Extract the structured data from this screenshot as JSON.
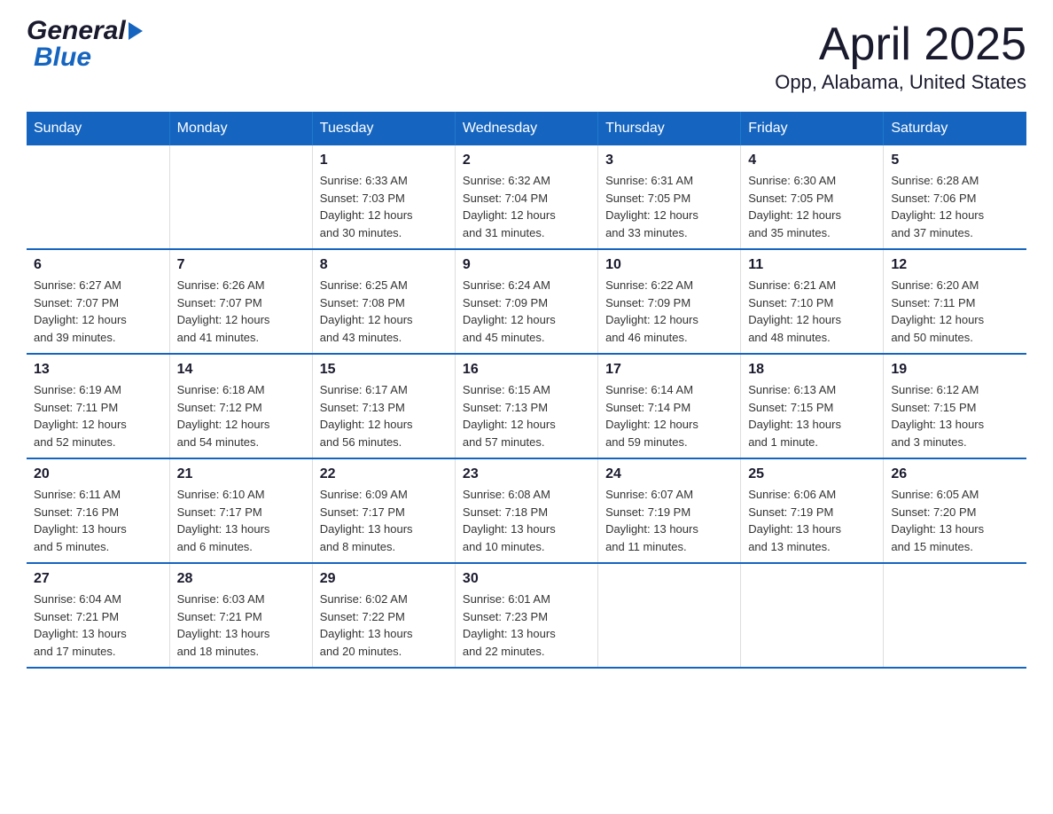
{
  "header": {
    "logo_general": "General",
    "logo_blue": "Blue",
    "month_title": "April 2025",
    "location": "Opp, Alabama, United States"
  },
  "days_of_week": [
    "Sunday",
    "Monday",
    "Tuesday",
    "Wednesday",
    "Thursday",
    "Friday",
    "Saturday"
  ],
  "weeks": [
    {
      "days": [
        {
          "number": "",
          "info": ""
        },
        {
          "number": "",
          "info": ""
        },
        {
          "number": "1",
          "info": "Sunrise: 6:33 AM\nSunset: 7:03 PM\nDaylight: 12 hours\nand 30 minutes."
        },
        {
          "number": "2",
          "info": "Sunrise: 6:32 AM\nSunset: 7:04 PM\nDaylight: 12 hours\nand 31 minutes."
        },
        {
          "number": "3",
          "info": "Sunrise: 6:31 AM\nSunset: 7:05 PM\nDaylight: 12 hours\nand 33 minutes."
        },
        {
          "number": "4",
          "info": "Sunrise: 6:30 AM\nSunset: 7:05 PM\nDaylight: 12 hours\nand 35 minutes."
        },
        {
          "number": "5",
          "info": "Sunrise: 6:28 AM\nSunset: 7:06 PM\nDaylight: 12 hours\nand 37 minutes."
        }
      ]
    },
    {
      "days": [
        {
          "number": "6",
          "info": "Sunrise: 6:27 AM\nSunset: 7:07 PM\nDaylight: 12 hours\nand 39 minutes."
        },
        {
          "number": "7",
          "info": "Sunrise: 6:26 AM\nSunset: 7:07 PM\nDaylight: 12 hours\nand 41 minutes."
        },
        {
          "number": "8",
          "info": "Sunrise: 6:25 AM\nSunset: 7:08 PM\nDaylight: 12 hours\nand 43 minutes."
        },
        {
          "number": "9",
          "info": "Sunrise: 6:24 AM\nSunset: 7:09 PM\nDaylight: 12 hours\nand 45 minutes."
        },
        {
          "number": "10",
          "info": "Sunrise: 6:22 AM\nSunset: 7:09 PM\nDaylight: 12 hours\nand 46 minutes."
        },
        {
          "number": "11",
          "info": "Sunrise: 6:21 AM\nSunset: 7:10 PM\nDaylight: 12 hours\nand 48 minutes."
        },
        {
          "number": "12",
          "info": "Sunrise: 6:20 AM\nSunset: 7:11 PM\nDaylight: 12 hours\nand 50 minutes."
        }
      ]
    },
    {
      "days": [
        {
          "number": "13",
          "info": "Sunrise: 6:19 AM\nSunset: 7:11 PM\nDaylight: 12 hours\nand 52 minutes."
        },
        {
          "number": "14",
          "info": "Sunrise: 6:18 AM\nSunset: 7:12 PM\nDaylight: 12 hours\nand 54 minutes."
        },
        {
          "number": "15",
          "info": "Sunrise: 6:17 AM\nSunset: 7:13 PM\nDaylight: 12 hours\nand 56 minutes."
        },
        {
          "number": "16",
          "info": "Sunrise: 6:15 AM\nSunset: 7:13 PM\nDaylight: 12 hours\nand 57 minutes."
        },
        {
          "number": "17",
          "info": "Sunrise: 6:14 AM\nSunset: 7:14 PM\nDaylight: 12 hours\nand 59 minutes."
        },
        {
          "number": "18",
          "info": "Sunrise: 6:13 AM\nSunset: 7:15 PM\nDaylight: 13 hours\nand 1 minute."
        },
        {
          "number": "19",
          "info": "Sunrise: 6:12 AM\nSunset: 7:15 PM\nDaylight: 13 hours\nand 3 minutes."
        }
      ]
    },
    {
      "days": [
        {
          "number": "20",
          "info": "Sunrise: 6:11 AM\nSunset: 7:16 PM\nDaylight: 13 hours\nand 5 minutes."
        },
        {
          "number": "21",
          "info": "Sunrise: 6:10 AM\nSunset: 7:17 PM\nDaylight: 13 hours\nand 6 minutes."
        },
        {
          "number": "22",
          "info": "Sunrise: 6:09 AM\nSunset: 7:17 PM\nDaylight: 13 hours\nand 8 minutes."
        },
        {
          "number": "23",
          "info": "Sunrise: 6:08 AM\nSunset: 7:18 PM\nDaylight: 13 hours\nand 10 minutes."
        },
        {
          "number": "24",
          "info": "Sunrise: 6:07 AM\nSunset: 7:19 PM\nDaylight: 13 hours\nand 11 minutes."
        },
        {
          "number": "25",
          "info": "Sunrise: 6:06 AM\nSunset: 7:19 PM\nDaylight: 13 hours\nand 13 minutes."
        },
        {
          "number": "26",
          "info": "Sunrise: 6:05 AM\nSunset: 7:20 PM\nDaylight: 13 hours\nand 15 minutes."
        }
      ]
    },
    {
      "days": [
        {
          "number": "27",
          "info": "Sunrise: 6:04 AM\nSunset: 7:21 PM\nDaylight: 13 hours\nand 17 minutes."
        },
        {
          "number": "28",
          "info": "Sunrise: 6:03 AM\nSunset: 7:21 PM\nDaylight: 13 hours\nand 18 minutes."
        },
        {
          "number": "29",
          "info": "Sunrise: 6:02 AM\nSunset: 7:22 PM\nDaylight: 13 hours\nand 20 minutes."
        },
        {
          "number": "30",
          "info": "Sunrise: 6:01 AM\nSunset: 7:23 PM\nDaylight: 13 hours\nand 22 minutes."
        },
        {
          "number": "",
          "info": ""
        },
        {
          "number": "",
          "info": ""
        },
        {
          "number": "",
          "info": ""
        }
      ]
    }
  ]
}
